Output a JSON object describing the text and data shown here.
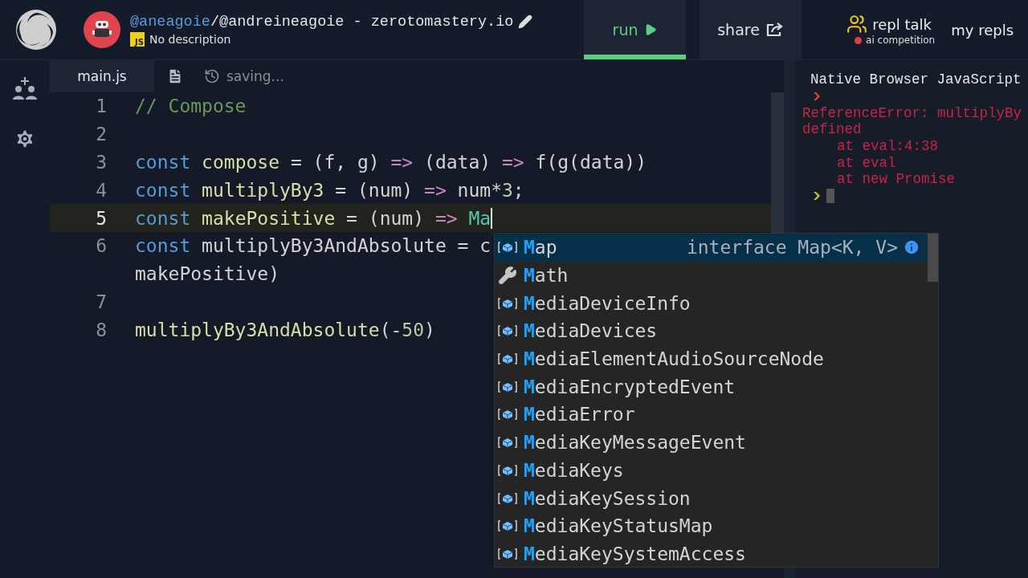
{
  "header": {
    "owner": "@aneagoie",
    "repl_name": "/@andreineagoie - zerotomastery.io",
    "language_badge": "JS",
    "description": "No description",
    "nav": [
      {
        "label": "run",
        "kind": "run",
        "selected": true
      },
      {
        "label": "share",
        "kind": "share",
        "selected": false
      }
    ],
    "repl_talk": {
      "label": "repl talk",
      "subtitle": "ai competition"
    },
    "my_repls": "my repls"
  },
  "editor_tabs": [
    {
      "label": "main.js",
      "kind": "file",
      "selected": true
    },
    {
      "kind": "notes",
      "selected": false
    }
  ],
  "save_status": "saving...",
  "code_lines": [
    {
      "number": "1",
      "current": false,
      "tokens": [
        {
          "text": "// Compose",
          "kind": "comment"
        }
      ]
    },
    {
      "number": "2",
      "current": false
    },
    {
      "number": "3",
      "current": false,
      "tokens": [
        {
          "text": "const ",
          "kind": "keyword"
        },
        {
          "text": "compose",
          "kind": "function"
        },
        {
          "text": " = (f, g) ",
          "kind": "plain"
        },
        {
          "text": "=>",
          "kind": "arrow"
        },
        {
          "text": " (data) ",
          "kind": "plain"
        },
        {
          "text": "=>",
          "kind": "arrow"
        },
        {
          "text": " f(g(data))",
          "kind": "plain"
        }
      ]
    },
    {
      "number": "4",
      "current": false,
      "tokens": [
        {
          "text": "const ",
          "kind": "keyword"
        },
        {
          "text": "multiplyBy3",
          "kind": "function"
        },
        {
          "text": " = (num) ",
          "kind": "plain"
        },
        {
          "text": "=>",
          "kind": "arrow"
        },
        {
          "text": " num*",
          "kind": "plain"
        },
        {
          "text": "3",
          "kind": "number"
        },
        {
          "text": ";",
          "kind": "plain"
        }
      ]
    },
    {
      "number": "5",
      "current": true,
      "tokens": [
        {
          "text": "const ",
          "kind": "keyword"
        },
        {
          "text": "makePositive",
          "kind": "function"
        },
        {
          "text": " = (num) ",
          "kind": "plain"
        },
        {
          "text": "=> ",
          "kind": "arrow"
        },
        {
          "text": "Ma",
          "kind": "type"
        }
      ]
    },
    {
      "number": "6",
      "current": false,
      "tokens": [
        {
          "text": "const",
          "kind": "keyword"
        },
        {
          "text": " multiplyBy3AndAbsolute = c",
          "kind": "plain"
        }
      ],
      "wrap": [
        {
          "text": "makePositive)",
          "kind": "plain"
        }
      ]
    },
    {
      "number": "7",
      "current": false
    },
    {
      "number": "8",
      "current": false,
      "tokens": [
        {
          "text": "multiplyBy3AndAbsolute",
          "kind": "function"
        },
        {
          "text": "(-",
          "kind": "plain"
        },
        {
          "text": "50",
          "kind": "number"
        },
        {
          "text": ")",
          "kind": "plain"
        }
      ]
    }
  ],
  "suggestions": {
    "detail": "interface Map<K, V>",
    "items": [
      {
        "match": "M",
        "rest": "ap",
        "kind": "interface",
        "selected": true
      },
      {
        "match": "M",
        "rest": "ath",
        "kind": "module",
        "selected": false
      },
      {
        "match": "M",
        "rest": "ediaDeviceInfo",
        "kind": "interface",
        "selected": false
      },
      {
        "match": "M",
        "rest": "ediaDevices",
        "kind": "interface",
        "selected": false
      },
      {
        "match": "M",
        "rest": "ediaElementAudioSourceNode",
        "kind": "interface",
        "selected": false
      },
      {
        "match": "M",
        "rest": "ediaEncryptedEvent",
        "kind": "interface",
        "selected": false
      },
      {
        "match": "M",
        "rest": "ediaError",
        "kind": "interface",
        "selected": false
      },
      {
        "match": "M",
        "rest": "ediaKeyMessageEvent",
        "kind": "interface",
        "selected": false
      },
      {
        "match": "M",
        "rest": "ediaKeys",
        "kind": "interface",
        "selected": false
      },
      {
        "match": "M",
        "rest": "ediaKeySession",
        "kind": "interface",
        "selected": false
      },
      {
        "match": "M",
        "rest": "ediaKeyStatusMap",
        "kind": "interface",
        "selected": false
      },
      {
        "match": "M",
        "rest": "ediaKeySystemAccess",
        "kind": "interface",
        "selected": false
      }
    ]
  },
  "console": [
    {
      "kind": "banner",
      "text": "Native Browser JavaScript"
    },
    {
      "kind": "prompt"
    },
    {
      "kind": "error",
      "text": "ReferenceError: multiplyBy"
    },
    {
      "kind": "error",
      "text": "defined"
    },
    {
      "kind": "trace",
      "text": "at eval:4:38"
    },
    {
      "kind": "trace",
      "text": "at eval"
    },
    {
      "kind": "trace",
      "text": "at new Promise"
    },
    {
      "kind": "input"
    }
  ]
}
